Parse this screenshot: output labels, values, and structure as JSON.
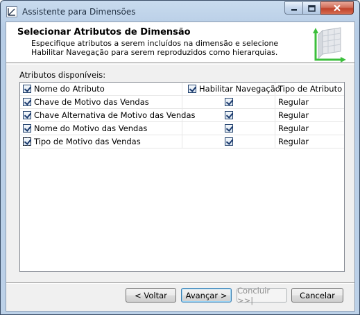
{
  "window": {
    "title": "Assistente para Dimensões"
  },
  "header": {
    "title": "Selecionar Atributos de Dimensão",
    "description_line1": "Especifique atributos a serem incluídos na dimensão e selecione",
    "description_line2": "Habilitar Navegação para serem reproduzidos como hierarquias."
  },
  "attributes": {
    "section_label": "Atributos disponíveis:",
    "columns": [
      "Nome do Atributo",
      "Habilitar Navegação",
      "Tipo de Atributo"
    ],
    "header_checked": {
      "name": true,
      "browse": true
    },
    "rows": [
      {
        "name": "Chave de Motivo das Vendas",
        "include": true,
        "browse": true,
        "type": "Regular"
      },
      {
        "name": "Chave Alternativa de Motivo das Vendas",
        "include": true,
        "browse": true,
        "type": "Regular"
      },
      {
        "name": "Nome do Motivo das Vendas",
        "include": true,
        "browse": true,
        "type": "Regular"
      },
      {
        "name": "Tipo de Motivo das Vendas",
        "include": true,
        "browse": true,
        "type": "Regular"
      }
    ]
  },
  "buttons": {
    "back": "< Voltar",
    "next": "Avançar >",
    "finish": "Concluir >>|",
    "cancel": "Cancelar"
  },
  "colors": {
    "close_button": "#c0432b",
    "header_graphic_arrow": "#3cbf3c"
  },
  "icons": {
    "app": "wizard-icon",
    "minimize": "minimize-icon",
    "maximize": "maximize-icon",
    "close": "close-icon",
    "header": "dimension-cube-icon"
  }
}
